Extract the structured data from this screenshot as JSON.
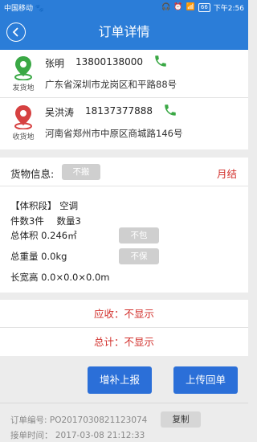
{
  "status_bar": {
    "carrier": "中国移动 🐾",
    "battery": "66",
    "time": "下午2:56"
  },
  "header": {
    "title": "订单详情",
    "back_icon": "back-arrow-icon"
  },
  "sender": {
    "name": "张明",
    "phone": "13800138000",
    "address": "广东省深圳市龙岗区和平路88号",
    "label": "发货地",
    "pin_color": "#3aa845"
  },
  "receiver": {
    "name": "吴洪涛",
    "phone": "18137377888",
    "address": "河南省郑州市中原区商城路146号",
    "label": "收货地",
    "pin_color": "#d64141"
  },
  "goods": {
    "label": "货物信息:",
    "status": "不搬",
    "settlement": "月结",
    "category": "【体积段】 空调",
    "count": "件数3件",
    "quantity": "数量3",
    "total_volume": "总体积  0.246㎡",
    "total_weight": "总重量   0.0kg",
    "dimensions": "长宽高  0.0×0.0×0.0m",
    "pack_tag": "不包",
    "insure_tag": "不保"
  },
  "totals": {
    "receivable": "应收：不显示",
    "total": "总计：不显示"
  },
  "actions": {
    "supplement": "增补上报",
    "upload": "上传回单"
  },
  "order": {
    "number": "订单编号: PO2017030821123074",
    "time": "接单时间： 2017-03-08 21:12:33",
    "copy": "复制"
  },
  "colors": {
    "primary": "#2b7dd8",
    "accent_red": "#d2302c",
    "phone_green": "#3aa845"
  }
}
